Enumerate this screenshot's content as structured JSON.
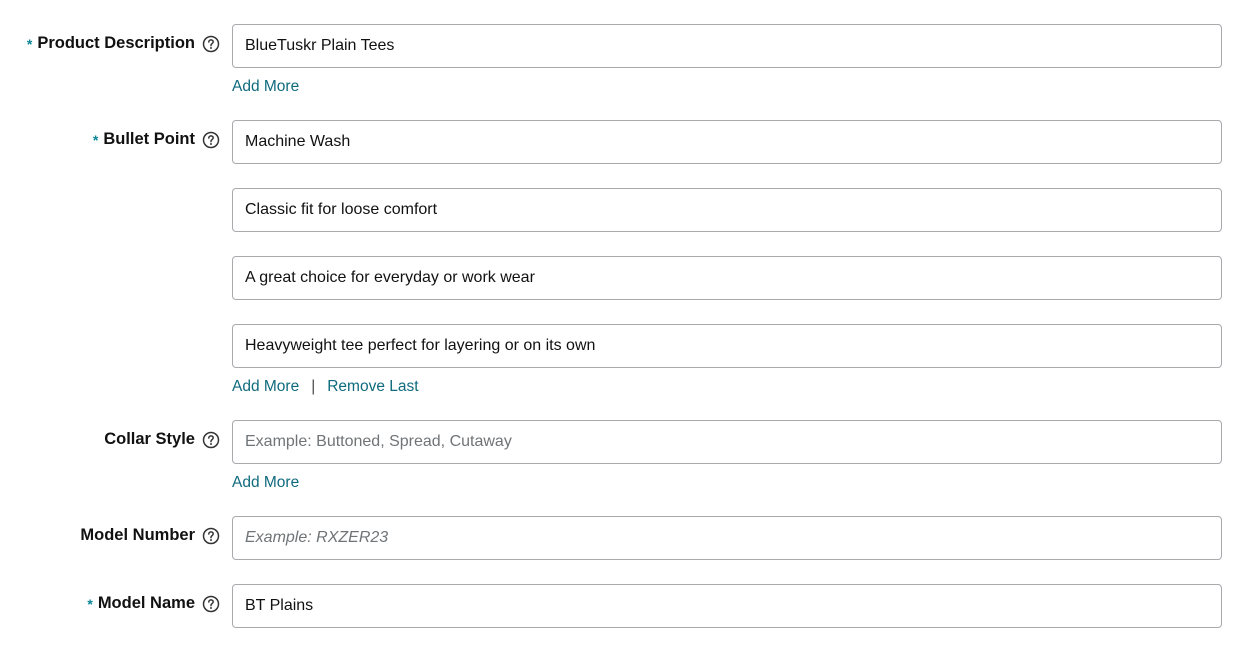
{
  "actions": {
    "add_more": "Add More",
    "remove_last": "Remove Last",
    "separator": "|"
  },
  "fields": {
    "product_description": {
      "label": "Product Description",
      "required_marker": "*",
      "value": "BlueTuskr Plain Tees"
    },
    "bullet_point": {
      "label": "Bullet Point",
      "required_marker": "*",
      "values": [
        "Machine Wash",
        "Classic fit for loose comfort",
        "A great choice for everyday or work wear",
        "Heavyweight tee perfect for layering or on its own"
      ]
    },
    "collar_style": {
      "label": "Collar Style",
      "value": "",
      "placeholder": "Example: Buttoned, Spread, Cutaway"
    },
    "model_number": {
      "label": "Model Number",
      "value": "",
      "placeholder": "Example: RXZER23"
    },
    "model_name": {
      "label": "Model Name",
      "required_marker": "*",
      "value": "BT Plains"
    }
  }
}
